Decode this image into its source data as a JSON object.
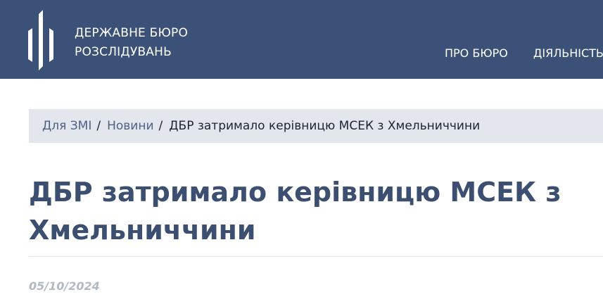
{
  "header": {
    "logo_line1": "ДЕРЖАВНЕ БЮРО",
    "logo_line2": "РОЗСЛІДУВАНЬ",
    "nav": [
      "ПРО БЮРО",
      "ДІЯЛЬНІСТЬ"
    ],
    "background_color": "#3c5178"
  },
  "breadcrumb": {
    "items": [
      "Для ЗМІ",
      "Новини"
    ],
    "separator": "/",
    "current": "ДБР затримало керівницю МСЕК з Хмельниччини"
  },
  "article": {
    "title": "ДБР затримало керівницю МСЕК з Хмельниччини",
    "date": "05/10/2024"
  }
}
